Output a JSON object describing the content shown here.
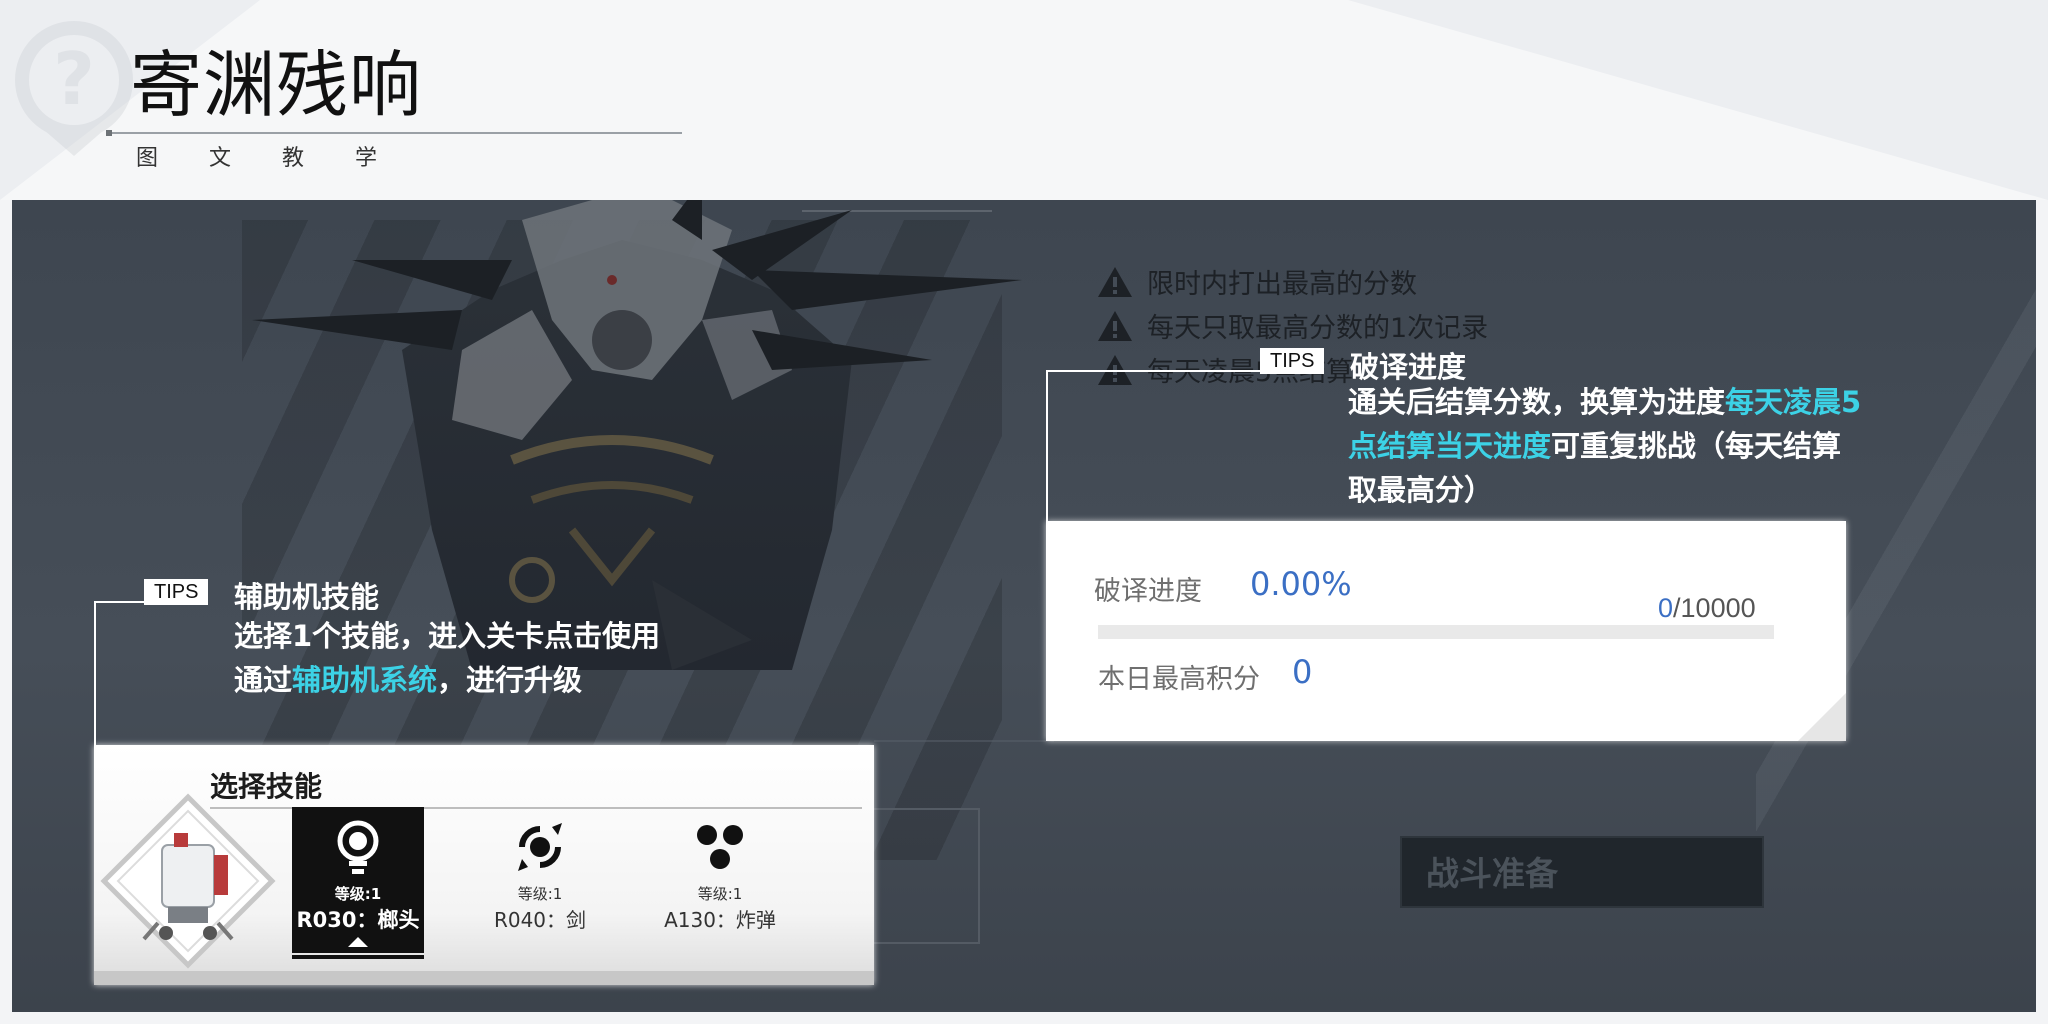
{
  "header": {
    "title": "寄渊残响",
    "subtitle": "图 文 教 学"
  },
  "warnings": [
    "限时内打出最高的分数",
    "每天只取最高分数的1次记录",
    "每天凌晨5点结算"
  ],
  "tips_progress": {
    "tag": "TIPS",
    "title": "破译进度",
    "text_a": "通关后结算分数，换算为进度",
    "text_highlight": "每天凌晨5点结算当天进度",
    "text_b": "可重复挑战（每天结算取最高分）"
  },
  "progress_card": {
    "progress_label": "破译进度",
    "progress_percent": "0.00%",
    "current": "0",
    "total": "/10000",
    "progress_fraction": 0,
    "score_label": "本日最高积分",
    "score_value": "0"
  },
  "tips_skill": {
    "tag": "TIPS",
    "title": "辅助机技能",
    "line1": "选择1个技能，进入关卡点击使用",
    "line2_a": "通过",
    "line2_highlight": "辅助机系统",
    "line2_b": "，进行升级"
  },
  "skill_panel": {
    "title": "选择技能",
    "skills": [
      {
        "level": "等级:1",
        "name": "R030：榔头",
        "icon": "hammer-icon",
        "selected": true
      },
      {
        "level": "等级:1",
        "name": "R040：剑",
        "icon": "sword-icon",
        "selected": false
      },
      {
        "level": "等级:1",
        "name": "A130：炸弹",
        "icon": "bomb-icon",
        "selected": false
      }
    ]
  },
  "battle_button": {
    "label": "战斗准备"
  },
  "colors": {
    "highlight": "#3cd2e6",
    "value_blue": "#3b6fc4",
    "scene_bg": "#444c56"
  }
}
